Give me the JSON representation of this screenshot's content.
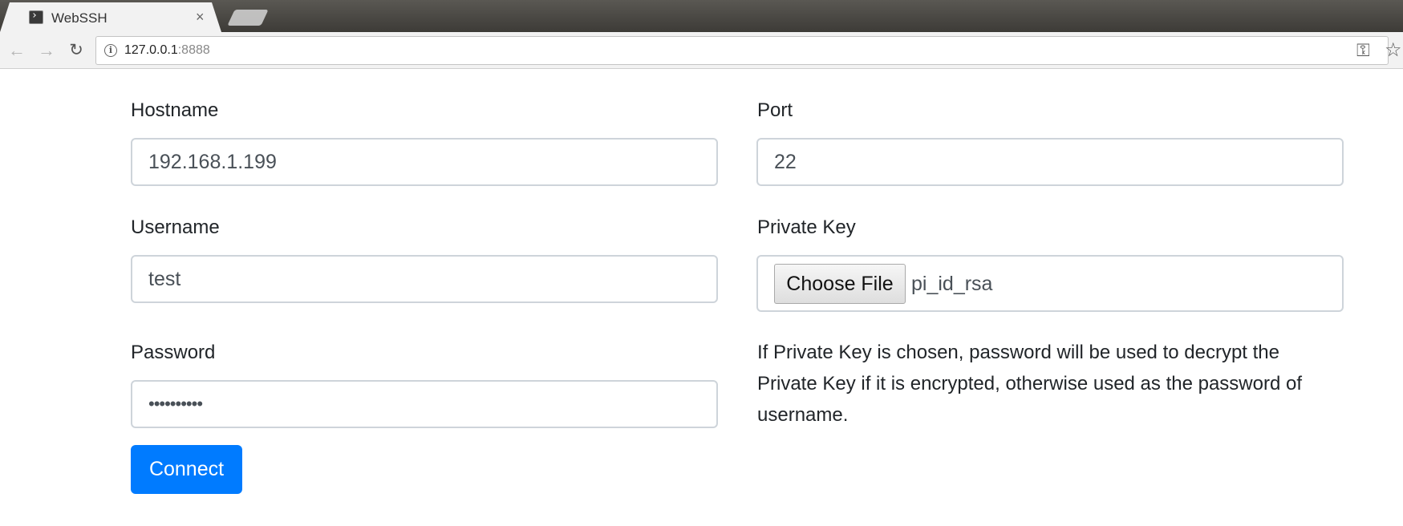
{
  "browser": {
    "tab_title": "WebSSH",
    "tab_close": "×",
    "url_host": "127.0.0.1",
    "url_port": ":8888",
    "icons": [
      "terminal-favicon-icon",
      "back-arrow-icon",
      "forward-arrow-icon",
      "reload-icon",
      "info-icon",
      "key-icon",
      "star-icon"
    ]
  },
  "form": {
    "hostname": {
      "label": "Hostname",
      "value": "192.168.1.199"
    },
    "port": {
      "label": "Port",
      "value": "22"
    },
    "username": {
      "label": "Username",
      "value": "test"
    },
    "private_key": {
      "label": "Private Key",
      "button": "Choose File",
      "filename": "pi_id_rsa"
    },
    "password": {
      "label": "Password",
      "value": "••••••••••"
    },
    "help_text": "If Private Key is chosen, password will be used to decrypt the Private Key if it is encrypted, otherwise used as the password of username.",
    "connect_label": "Connect"
  },
  "colors": {
    "primary": "#007bff",
    "input_border": "#ced4da",
    "text": "#212529"
  }
}
